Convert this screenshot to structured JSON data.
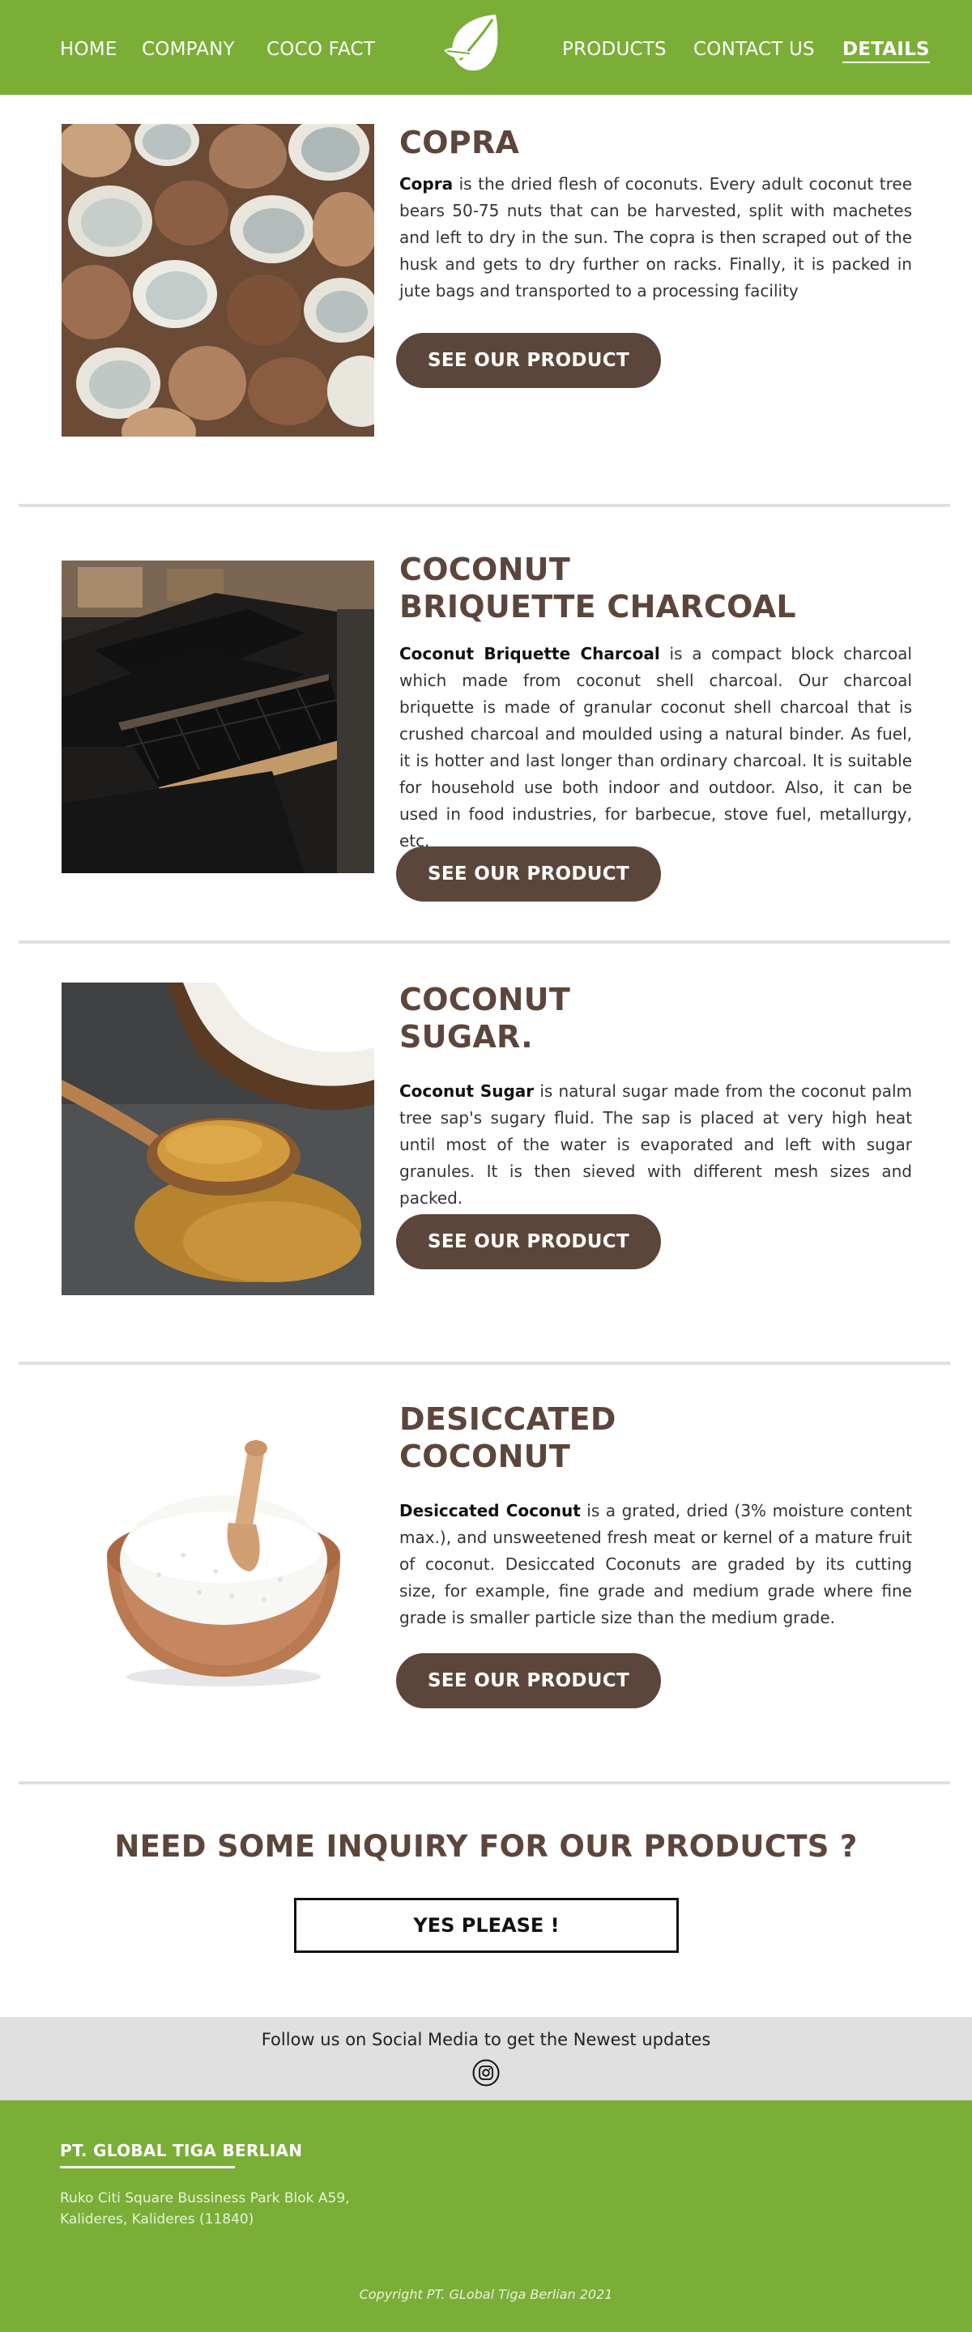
{
  "nav": {
    "links": [
      "HOME",
      "COMPANY",
      "COCO FACT",
      "PRODUCTS",
      "CONTACT US",
      "DETAILS"
    ]
  },
  "products": [
    {
      "title_lines": [
        "COPRA"
      ],
      "term": "Copra",
      "desc": " is the dried flesh of coconuts. Every adult coconut tree bears 50-75 nuts that can be harvested, split with machetes and left to dry in the sun. The copra is then scraped out of the husk and gets to dry further on racks. Finally, it is packed in jute bags and transported to a processing facility",
      "button": "SEE OUR PRODUCT"
    },
    {
      "title_lines": [
        "COCONUT",
        "BRIQUETTE CHARCOAL"
      ],
      "term": "Coconut Briquette Charcoal",
      "desc": " is a compact block charcoal which made from coconut shell charcoal. Our charcoal briquette is made of granular coconut shell charcoal that is crushed charcoal and moulded using a natural binder. As fuel, it is hotter and last longer than ordinary charcoal. It is suitable for household use both indoor and outdoor. Also, it can be used in food industries, for barbecue, stove fuel, metallurgy, etc.",
      "button": "SEE OUR PRODUCT"
    },
    {
      "title_lines": [
        "COCONUT",
        "SUGAR."
      ],
      "term": "Coconut Sugar",
      "desc": " is natural sugar made from the coconut palm tree sap's sugary fluid. The sap is placed at very high heat until most of the water is evaporated and left with sugar granules. It is then sieved with different mesh sizes and packed.",
      "button": "SEE OUR PRODUCT"
    },
    {
      "title_lines": [
        "DESICCATED",
        "COCONUT"
      ],
      "term": "Desiccated Coconut",
      "desc": " is a grated, dried (3% moisture content max.), and unsweetened fresh meat or kernel of a mature fruit of coconut. Desiccated Coconuts are graded by its cutting size, for example, fine grade and medium grade where fine grade is smaller particle size than the medium grade.",
      "button": "SEE OUR PRODUCT"
    }
  ],
  "inquiry": {
    "title": "NEED SOME INQUIRY FOR OUR PRODUCTS ?",
    "button": "YES PLEASE !"
  },
  "social": {
    "text": "Follow us on Social Media to get the Newest updates",
    "icon": "instagram-icon"
  },
  "footer": {
    "company": "PT. GLOBAL TIGA BERLIAN",
    "address_lines": [
      "Ruko Citi Square Bussiness Park Blok A59,",
      "Kalideres, Kalideres (11840)"
    ],
    "copyright": "Copyright PT. GLobal Tiga Berlian 2021"
  },
  "colors": {
    "brand_green": "#7aae36",
    "brand_brown": "#5c463c",
    "divider_gray": "#e0e0e0"
  }
}
